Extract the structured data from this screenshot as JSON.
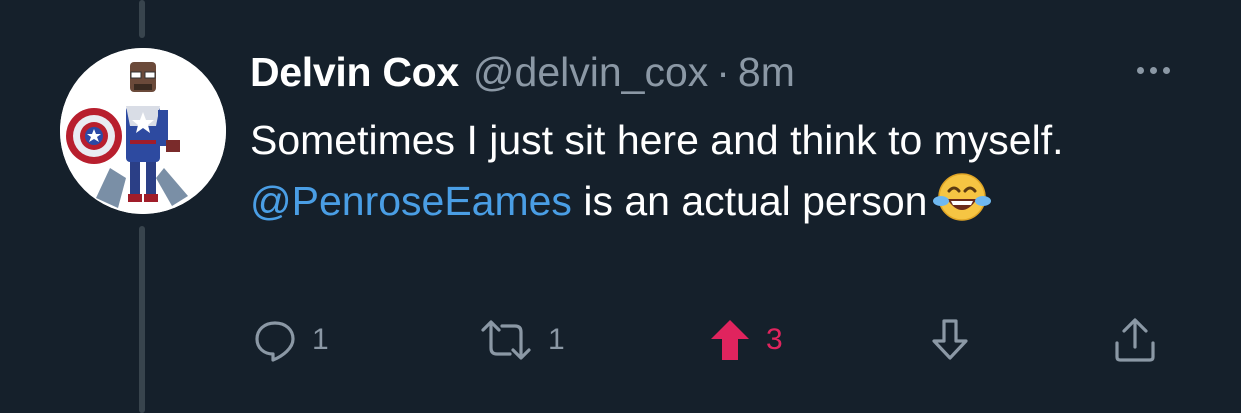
{
  "tweet": {
    "display_name": "Delvin Cox",
    "handle": "@delvin_cox",
    "separator": "·",
    "time": "8m",
    "text_part1": "Sometimes I just sit here and think to myself. ",
    "mention": "@PenroseEames",
    "text_part2": " is an actual person",
    "emoji": "😂"
  },
  "actions": {
    "reply_count": "1",
    "retweet_count": "1",
    "upvote_count": "3"
  },
  "colors": {
    "background": "#15202b",
    "text": "#ffffff",
    "muted": "#8b98a5",
    "mention": "#4a9ee5",
    "upvote_active": "#e0245e"
  },
  "icons": [
    "reply-icon",
    "retweet-icon",
    "upvote-icon",
    "downvote-icon",
    "share-icon",
    "more-icon"
  ]
}
